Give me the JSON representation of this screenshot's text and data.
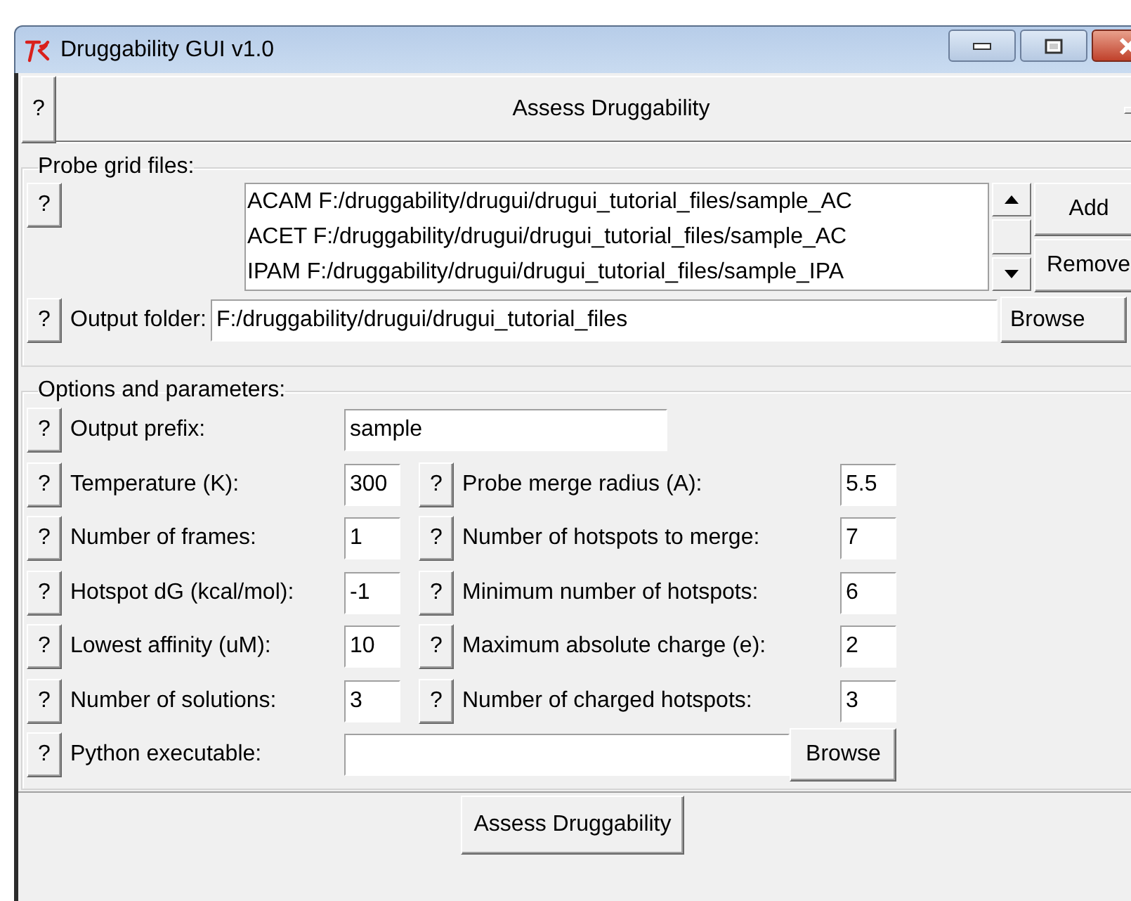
{
  "window": {
    "title": "Druggability GUI v1.0"
  },
  "header": {
    "help": "?",
    "title": "Assess Druggability"
  },
  "probe_grid_files": {
    "title": "Probe grid files:",
    "help": "?",
    "files": [
      {
        "text": "ACAM F:/druggability/drugui/drugui_tutorial_files/sample_AC",
        "selected": false
      },
      {
        "text": "ACET F:/druggability/drugui/drugui_tutorial_files/sample_AC",
        "selected": false
      },
      {
        "text": "IPAM F:/druggability/drugui/drugui_tutorial_files/sample_IPA",
        "selected": false
      }
    ],
    "buttons": [
      "Add",
      "Remove"
    ],
    "output_folder": {
      "help": "?",
      "label": "Output folder:",
      "value": "F:/druggability/drugui/drugui_tutorial_files",
      "button": "Browse"
    }
  },
  "options": {
    "title": "Options and parameters:",
    "output_prefix": {
      "help": "?",
      "label": "Output prefix:",
      "value": "sample"
    },
    "rows": [
      {
        "left": {
          "help": "?",
          "label": "Temperature (K):",
          "value": "300"
        },
        "right": {
          "help": "?",
          "label": "Probe merge radius (A):",
          "value": "5.5"
        }
      },
      {
        "left": {
          "help": "?",
          "label": "Number of frames:",
          "value": "1"
        },
        "right": {
          "help": "?",
          "label": "Number of hotspots to merge:",
          "value": "7"
        }
      },
      {
        "left": {
          "help": "?",
          "label": "Hotspot dG (kcal/mol):",
          "value": "-1"
        },
        "right": {
          "help": "?",
          "label": "Minimum number of hotspots:",
          "value": "6"
        }
      },
      {
        "left": {
          "help": "?",
          "label": "Lowest affinity (uM):",
          "value": "10"
        },
        "right": {
          "help": "?",
          "label": "Maximum absolute charge (e):",
          "value": "2"
        }
      },
      {
        "left": {
          "help": "?",
          "label": "Number of solutions:",
          "value": "3"
        },
        "right": {
          "help": "?",
          "label": "Number of charged hotspots:",
          "value": "3"
        }
      }
    ],
    "python": {
      "help": "?",
      "label": "Python executable:",
      "button": "Browse"
    }
  },
  "assess_button": "Assess Druggability"
}
